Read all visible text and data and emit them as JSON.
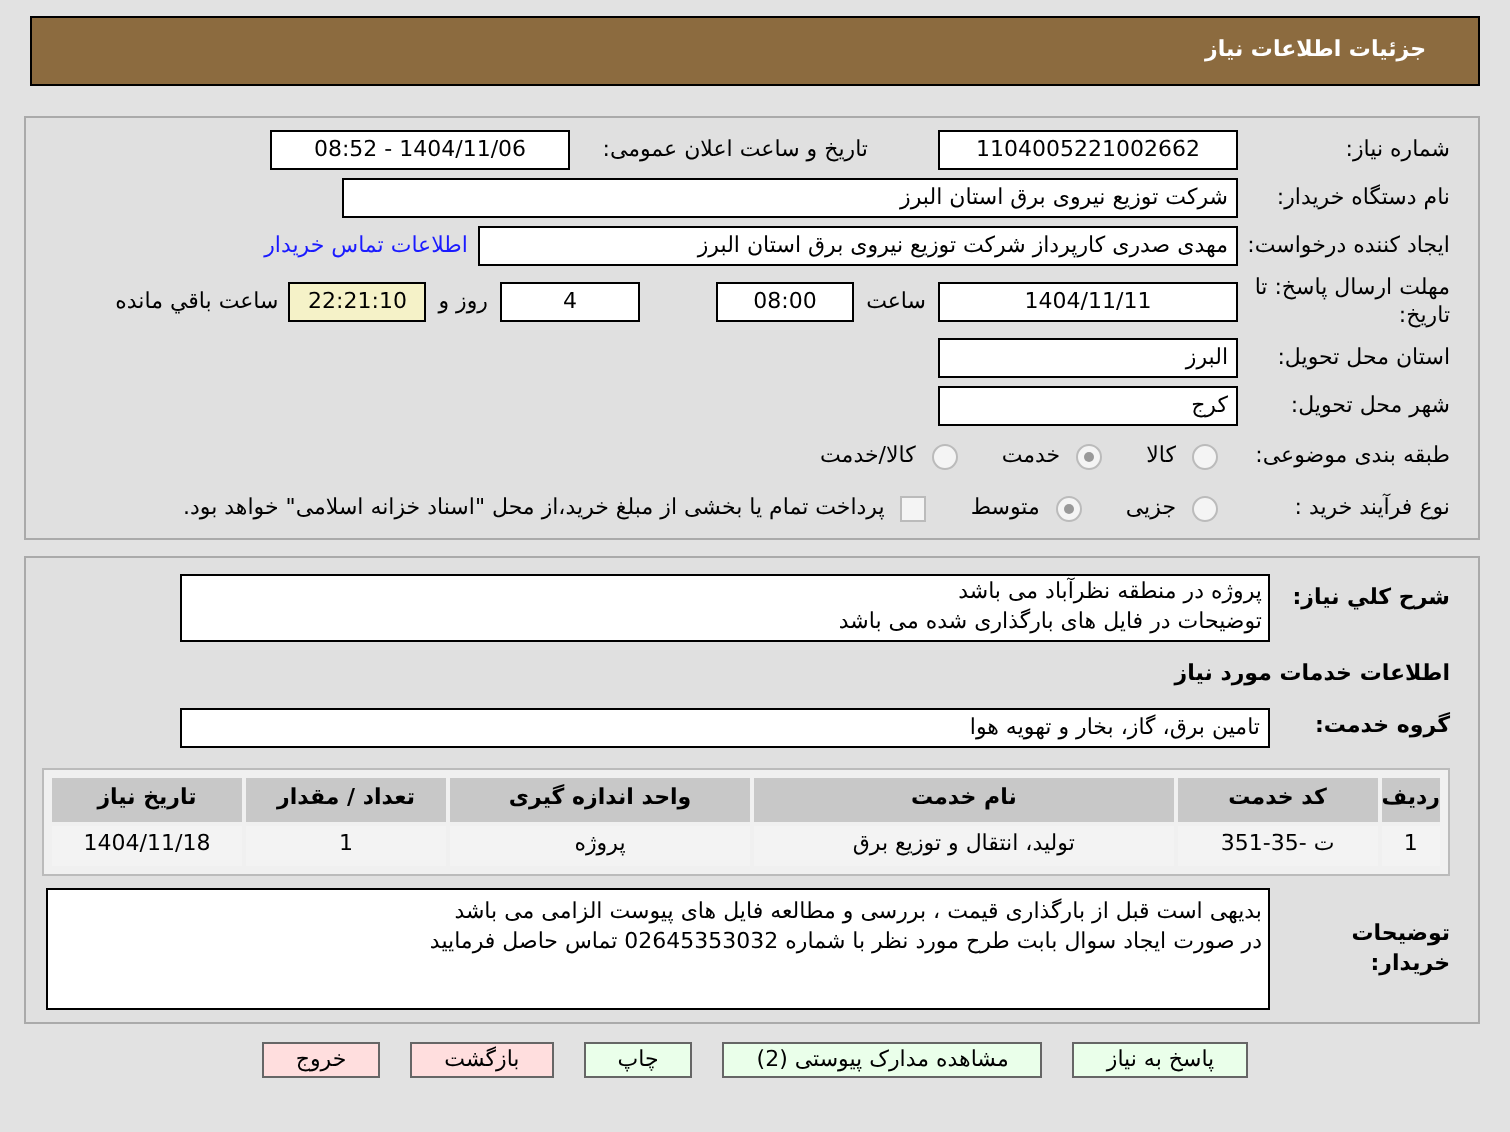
{
  "header": {
    "title": "جزئیات اطلاعات نیاز"
  },
  "details": {
    "need_number": {
      "label": "شماره نیاز:",
      "value": "1104005221002662"
    },
    "announce": {
      "label": "تاریخ و ساعت اعلان عمومی:",
      "value": "1404/11/06 - 08:52"
    },
    "buyer_org": {
      "label": "نام دستگاه خریدار:",
      "value": "شرکت توزیع نیروی برق استان البرز"
    },
    "requester": {
      "label": "ایجاد کننده درخواست:",
      "value": "مهدی صدری کارپرداز شرکت توزیع نیروی برق استان البرز",
      "link": "اطلاعات تماس خریدار"
    },
    "deadline": {
      "label": "مهلت ارسال پاسخ: تا تاریخ:",
      "date": "1404/11/11",
      "time_label": "ساعت",
      "time": "08:00",
      "days": "4",
      "days_label": "روز و",
      "remaining": "22:21:10",
      "remaining_label": "ساعت باقي مانده"
    },
    "province": {
      "label": "استان محل تحویل:",
      "value": "البرز"
    },
    "city": {
      "label": "شهر محل تحویل:",
      "value": "کرج"
    },
    "category": {
      "label": "طبقه بندی موضوعی:",
      "options": [
        {
          "label": "کالا",
          "selected": false
        },
        {
          "label": "خدمت",
          "selected": true
        },
        {
          "label": "کالا/خدمت",
          "selected": false
        }
      ]
    },
    "process": {
      "label": "نوع فرآیند خرید :",
      "options": [
        {
          "label": "جزیی",
          "selected": false
        },
        {
          "label": "متوسط",
          "selected": true
        }
      ],
      "payment": {
        "checked": false,
        "label": "پرداخت تمام یا بخشی از مبلغ خرید،از محل \"اسناد خزانه اسلامی\" خواهد بود."
      }
    }
  },
  "services": {
    "description": {
      "label": "شرح کلي نياز:",
      "lines": [
        "پروژه در منطقه نظرآباد می باشد",
        "توضیحات در فایل های بارگذاری شده می باشد"
      ]
    },
    "heading": "اطلاعات خدمات مورد نیاز",
    "group": {
      "label": "گروه خدمت:",
      "value": "تامین برق، گاز، بخار و تهویه هوا"
    },
    "table": {
      "columns": [
        "ردیف",
        "کد خدمت",
        "نام خدمت",
        "واحد اندازه گیری",
        "تعداد / مقدار",
        "تاریخ نیاز"
      ],
      "rows": [
        [
          "1",
          "ت -35-351",
          "تولید، انتقال و توزیع برق",
          "پروژه",
          "1",
          "1404/11/18"
        ]
      ]
    },
    "notes": {
      "label": "توضیحات خریدار:",
      "lines": [
        "بدیهی است قبل از بارگذاری قیمت ، بررسی و مطالعه فایل های پیوست الزامی می باشد",
        "در صورت ایجاد سوال بابت طرح مورد نظر با شماره 02645353032 تماس حاصل فرمایید"
      ]
    }
  },
  "buttons": [
    {
      "label": "پاسخ به نیاز",
      "color": "#eaffea"
    },
    {
      "label": "مشاهده مدارک پیوستی (2)",
      "color": "#eaffea"
    },
    {
      "label": "چاپ",
      "color": "#eaffea"
    },
    {
      "label": "بازگشت",
      "color": "#ffdede"
    },
    {
      "label": "خروج",
      "color": "#ffdede"
    }
  ]
}
